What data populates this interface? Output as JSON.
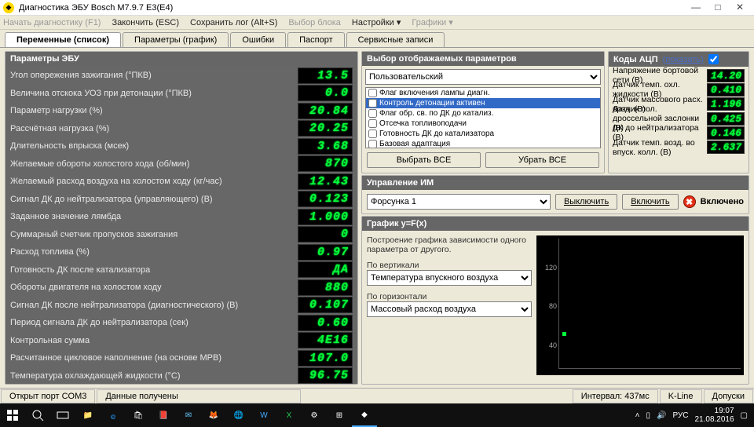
{
  "window": {
    "title": "Диагностика ЭБУ Bosch M7.9.7 E3(E4)"
  },
  "menu": {
    "start": "Начать диагностику (F1)",
    "stop": "Закончить (ESC)",
    "savelog": "Сохранить лог (Alt+S)",
    "blocksel": "Выбор блока",
    "settings": "Настройки ▾",
    "plots": "Графики ▾"
  },
  "tabs": [
    "Переменные (список)",
    "Параметры (график)",
    "Ошибки",
    "Паспорт",
    "Сервисные записи"
  ],
  "left_panel_title": "Параметры ЭБУ",
  "params": [
    {
      "label": "Угол опережения зажигания (°ПКВ)",
      "val": "13.5"
    },
    {
      "label": "Величина отскока УОЗ при детонации (°ПКВ)",
      "val": "0.0"
    },
    {
      "label": "Параметр нагрузки (%)",
      "val": "20.84"
    },
    {
      "label": "Рассчётная нагрузка (%)",
      "val": "20.25"
    },
    {
      "label": "Длительность впрыска (мсек)",
      "val": "3.68"
    },
    {
      "label": "Желаемые обороты холостого хода (об/мин)",
      "val": "870"
    },
    {
      "label": "Желаемый расход воздуха на холостом ходу (кг/час)",
      "val": "12.43"
    },
    {
      "label": "Сигнал ДК до нейтрализатора (управляющего) (В)",
      "val": "0.123"
    },
    {
      "label": "Заданное значение лямбда",
      "val": "1.000"
    },
    {
      "label": "Суммарный счетчик пропусков зажигания",
      "val": "0"
    },
    {
      "label": "Расход топлива (%)",
      "val": "0.97"
    },
    {
      "label": "Готовность ДК после катализатора",
      "val": "ДА"
    },
    {
      "label": "Обороты двигателя на холостом ходу",
      "val": "880"
    },
    {
      "label": "Сигнал ДК после нейтрализатора (диагностического) (В)",
      "val": "0.107"
    },
    {
      "label": "Период сигнала ДК до нейтрализатора (сек)",
      "val": "0.60"
    },
    {
      "label": "Контрольная сумма",
      "val": "4E16"
    },
    {
      "label": "Расчитанное цикловое наполнение (на основе МРВ)",
      "val": "107.0"
    },
    {
      "label": "Температура охлаждающей жидкости (°C)",
      "val": "96.75"
    }
  ],
  "selector": {
    "title": "Выбор отображаемых параметров",
    "dropdown": "Пользовательский",
    "items": [
      {
        "t": "Флаг включения лампы диагн.",
        "c": false,
        "sel": false
      },
      {
        "t": "Контроль детонации активен",
        "c": false,
        "sel": true
      },
      {
        "t": "Флаг обр. св. по ДК до катализ.",
        "c": false,
        "sel": false
      },
      {
        "t": "Отсечка топливоподачи",
        "c": false,
        "sel": false
      },
      {
        "t": "Готовность ДК до катализатора",
        "c": false,
        "sel": false
      },
      {
        "t": "Базовая адаптация",
        "c": false,
        "sel": false
      }
    ],
    "btn_all": "Выбрать ВСЕ",
    "btn_none": "Убрать ВСЕ"
  },
  "adc": {
    "title": "Коды АЦП",
    "show": "(показать)",
    "rows": [
      {
        "l": "Напряжение бортовой сети (В)",
        "v": "14.20"
      },
      {
        "l": "Датчик темп. охл. жидкости (В)",
        "v": "0.410"
      },
      {
        "l": "Датчик массового расх. возд. (В)",
        "v": "1.196"
      },
      {
        "l": "Датчик пол. дроссельной заслонки (В)",
        "v": "0.425"
      },
      {
        "l": "ДК до нейтрализатора (В)",
        "v": "0.146"
      },
      {
        "l": "Датчик темп. возд. во впуск. колл. (В)",
        "v": "2.637"
      }
    ]
  },
  "im": {
    "title": "Управление ИМ",
    "device": "Форсунка 1",
    "btn_off": "Выключить",
    "btn_on": "Включить",
    "status": "Включено"
  },
  "yfx": {
    "title": "График y=F(x)",
    "desc": "Построение графика зависимости одного параметра от другого.",
    "vlabel": "По вертикали",
    "vsel": "Температура впускного воздуха",
    "hlabel": "По горизонтали",
    "hsel": "Массовый расход воздуха",
    "ticks": [
      "120",
      "80",
      "40"
    ]
  },
  "status": {
    "port": "Открыт порт COM3",
    "recv": "Данные получены",
    "interval": "Интервал: 437мс",
    "kline": "K-Line",
    "tol": "Допуски"
  },
  "tray": {
    "lang": "РУС",
    "time": "19:07",
    "date": "21.08.2016"
  },
  "chart_data": {
    "type": "scatter",
    "title": "y=F(x)",
    "xlabel": "Массовый расход воздуха",
    "ylabel": "Температура впускного воздуха",
    "ylim": [
      0,
      160
    ],
    "yticks": [
      40,
      80,
      120
    ],
    "series": [
      {
        "name": "point",
        "x": [
          12
        ],
        "y": [
          40
        ]
      }
    ]
  }
}
